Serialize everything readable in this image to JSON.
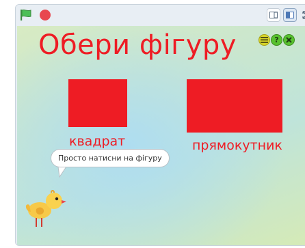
{
  "toolbar": {
    "left_controls": [
      {
        "icon": "green-flag-icon",
        "color": "#4cbf56"
      },
      {
        "icon": "stop-icon",
        "color": "#e8474f"
      }
    ],
    "right_controls": [
      {
        "icon": "small-stage-icon"
      },
      {
        "icon": "large-stage-icon"
      },
      {
        "icon": "fullscreen-icon"
      }
    ]
  },
  "stage": {
    "title": "Обери фігуру",
    "corner_buttons": [
      {
        "icon": "menu-lines-icon",
        "color": "#d8d52a"
      },
      {
        "icon": "help-icon",
        "text": "?",
        "color": "#58c22f"
      },
      {
        "icon": "close-icon",
        "color": "#58c22f"
      }
    ],
    "shapes": [
      {
        "name": "square",
        "label": "квадрат",
        "color": "#ee1c24"
      },
      {
        "name": "rectangle",
        "label": "прямокутник",
        "color": "#ee1c24"
      }
    ],
    "speech_bubble": "Просто натисни на фігуру",
    "sprite": "chick"
  }
}
